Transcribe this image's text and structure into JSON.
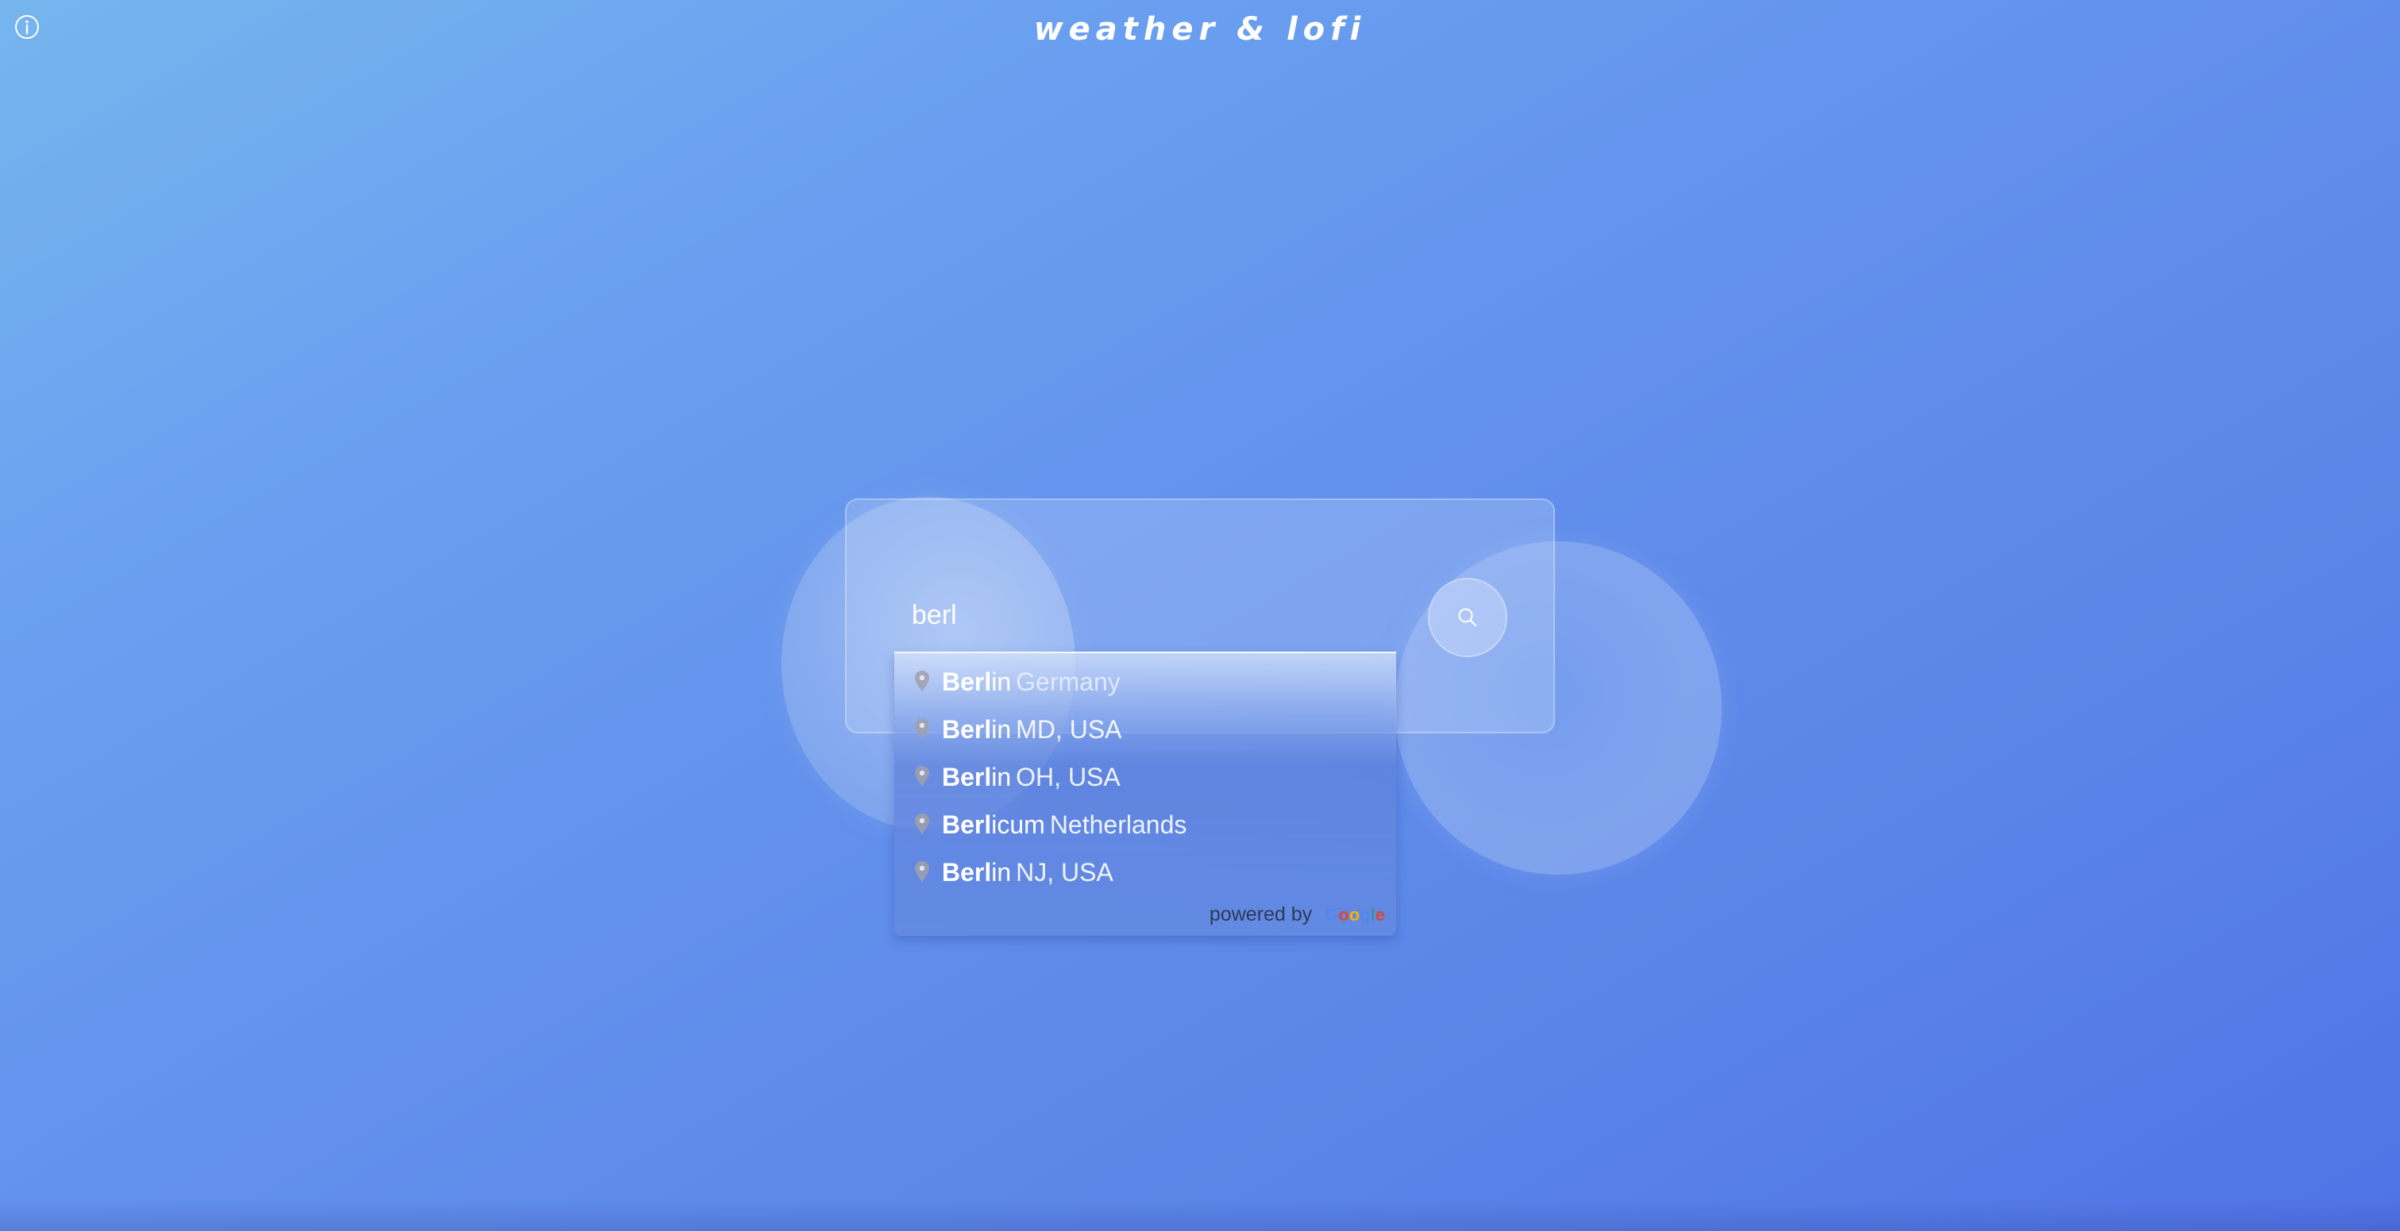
{
  "app": {
    "title": "weather & lofi"
  },
  "search": {
    "value": "berl",
    "placeholder": ""
  },
  "suggestions": [
    {
      "match": "Berl",
      "rest": "in",
      "secondary": "Germany"
    },
    {
      "match": "Berl",
      "rest": "in",
      "secondary": "MD, USA"
    },
    {
      "match": "Berl",
      "rest": "in",
      "secondary": "OH, USA"
    },
    {
      "match": "Berl",
      "rest": "icum",
      "secondary": "Netherlands"
    },
    {
      "match": "Berl",
      "rest": "in",
      "secondary": "NJ, USA"
    }
  ],
  "attribution": {
    "powered_by": "powered by",
    "logo": {
      "g1": "G",
      "o1": "o",
      "o2": "o",
      "g2": "g",
      "l": "l",
      "e": "e"
    }
  },
  "icons": {
    "info": "info-icon",
    "search": "search-icon",
    "pin": "map-pin-icon"
  },
  "colors": {
    "background_start": "#76b5ee",
    "background_end": "#5073e6",
    "text": "#ffffff"
  }
}
